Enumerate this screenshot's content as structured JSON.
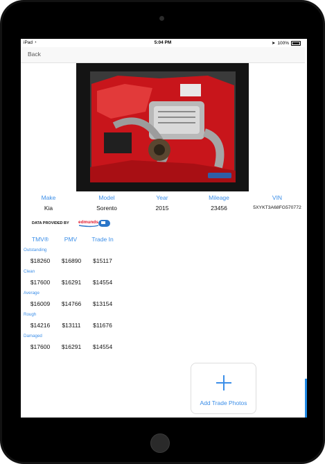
{
  "status": {
    "device": "iPad",
    "time": "5:04 PM",
    "battery": "100%"
  },
  "nav": {
    "back_label": "Back"
  },
  "vehicle": {
    "headers": [
      "Make",
      "Model",
      "Year",
      "Mileage",
      "VIN"
    ],
    "values": [
      "Kia",
      "Sorento",
      "2015",
      "23456",
      "5XYKT3A68FG570772"
    ]
  },
  "data_provider": {
    "label": "DATA PROVIDED BY",
    "logo_text": "edmunds.com"
  },
  "pricing": {
    "headers": [
      "TMV®",
      "PMV",
      "Trade In"
    ],
    "rows": [
      {
        "condition": "Outstanding",
        "values": [
          "$18260",
          "$16890",
          "$15117"
        ]
      },
      {
        "condition": "Clean",
        "values": [
          "$17600",
          "$16291",
          "$14554"
        ]
      },
      {
        "condition": "Average",
        "values": [
          "$16009",
          "$14766",
          "$13154"
        ]
      },
      {
        "condition": "Rough",
        "values": [
          "$14216",
          "$13111",
          "$11676"
        ]
      },
      {
        "condition": "Damaged",
        "values": [
          "$17600",
          "$16291",
          "$14554"
        ]
      }
    ]
  },
  "actions": {
    "add_photos_label": "Add Trade Photos"
  },
  "colors": {
    "accent": "#3b8ee8",
    "device_frame": "#121212"
  }
}
